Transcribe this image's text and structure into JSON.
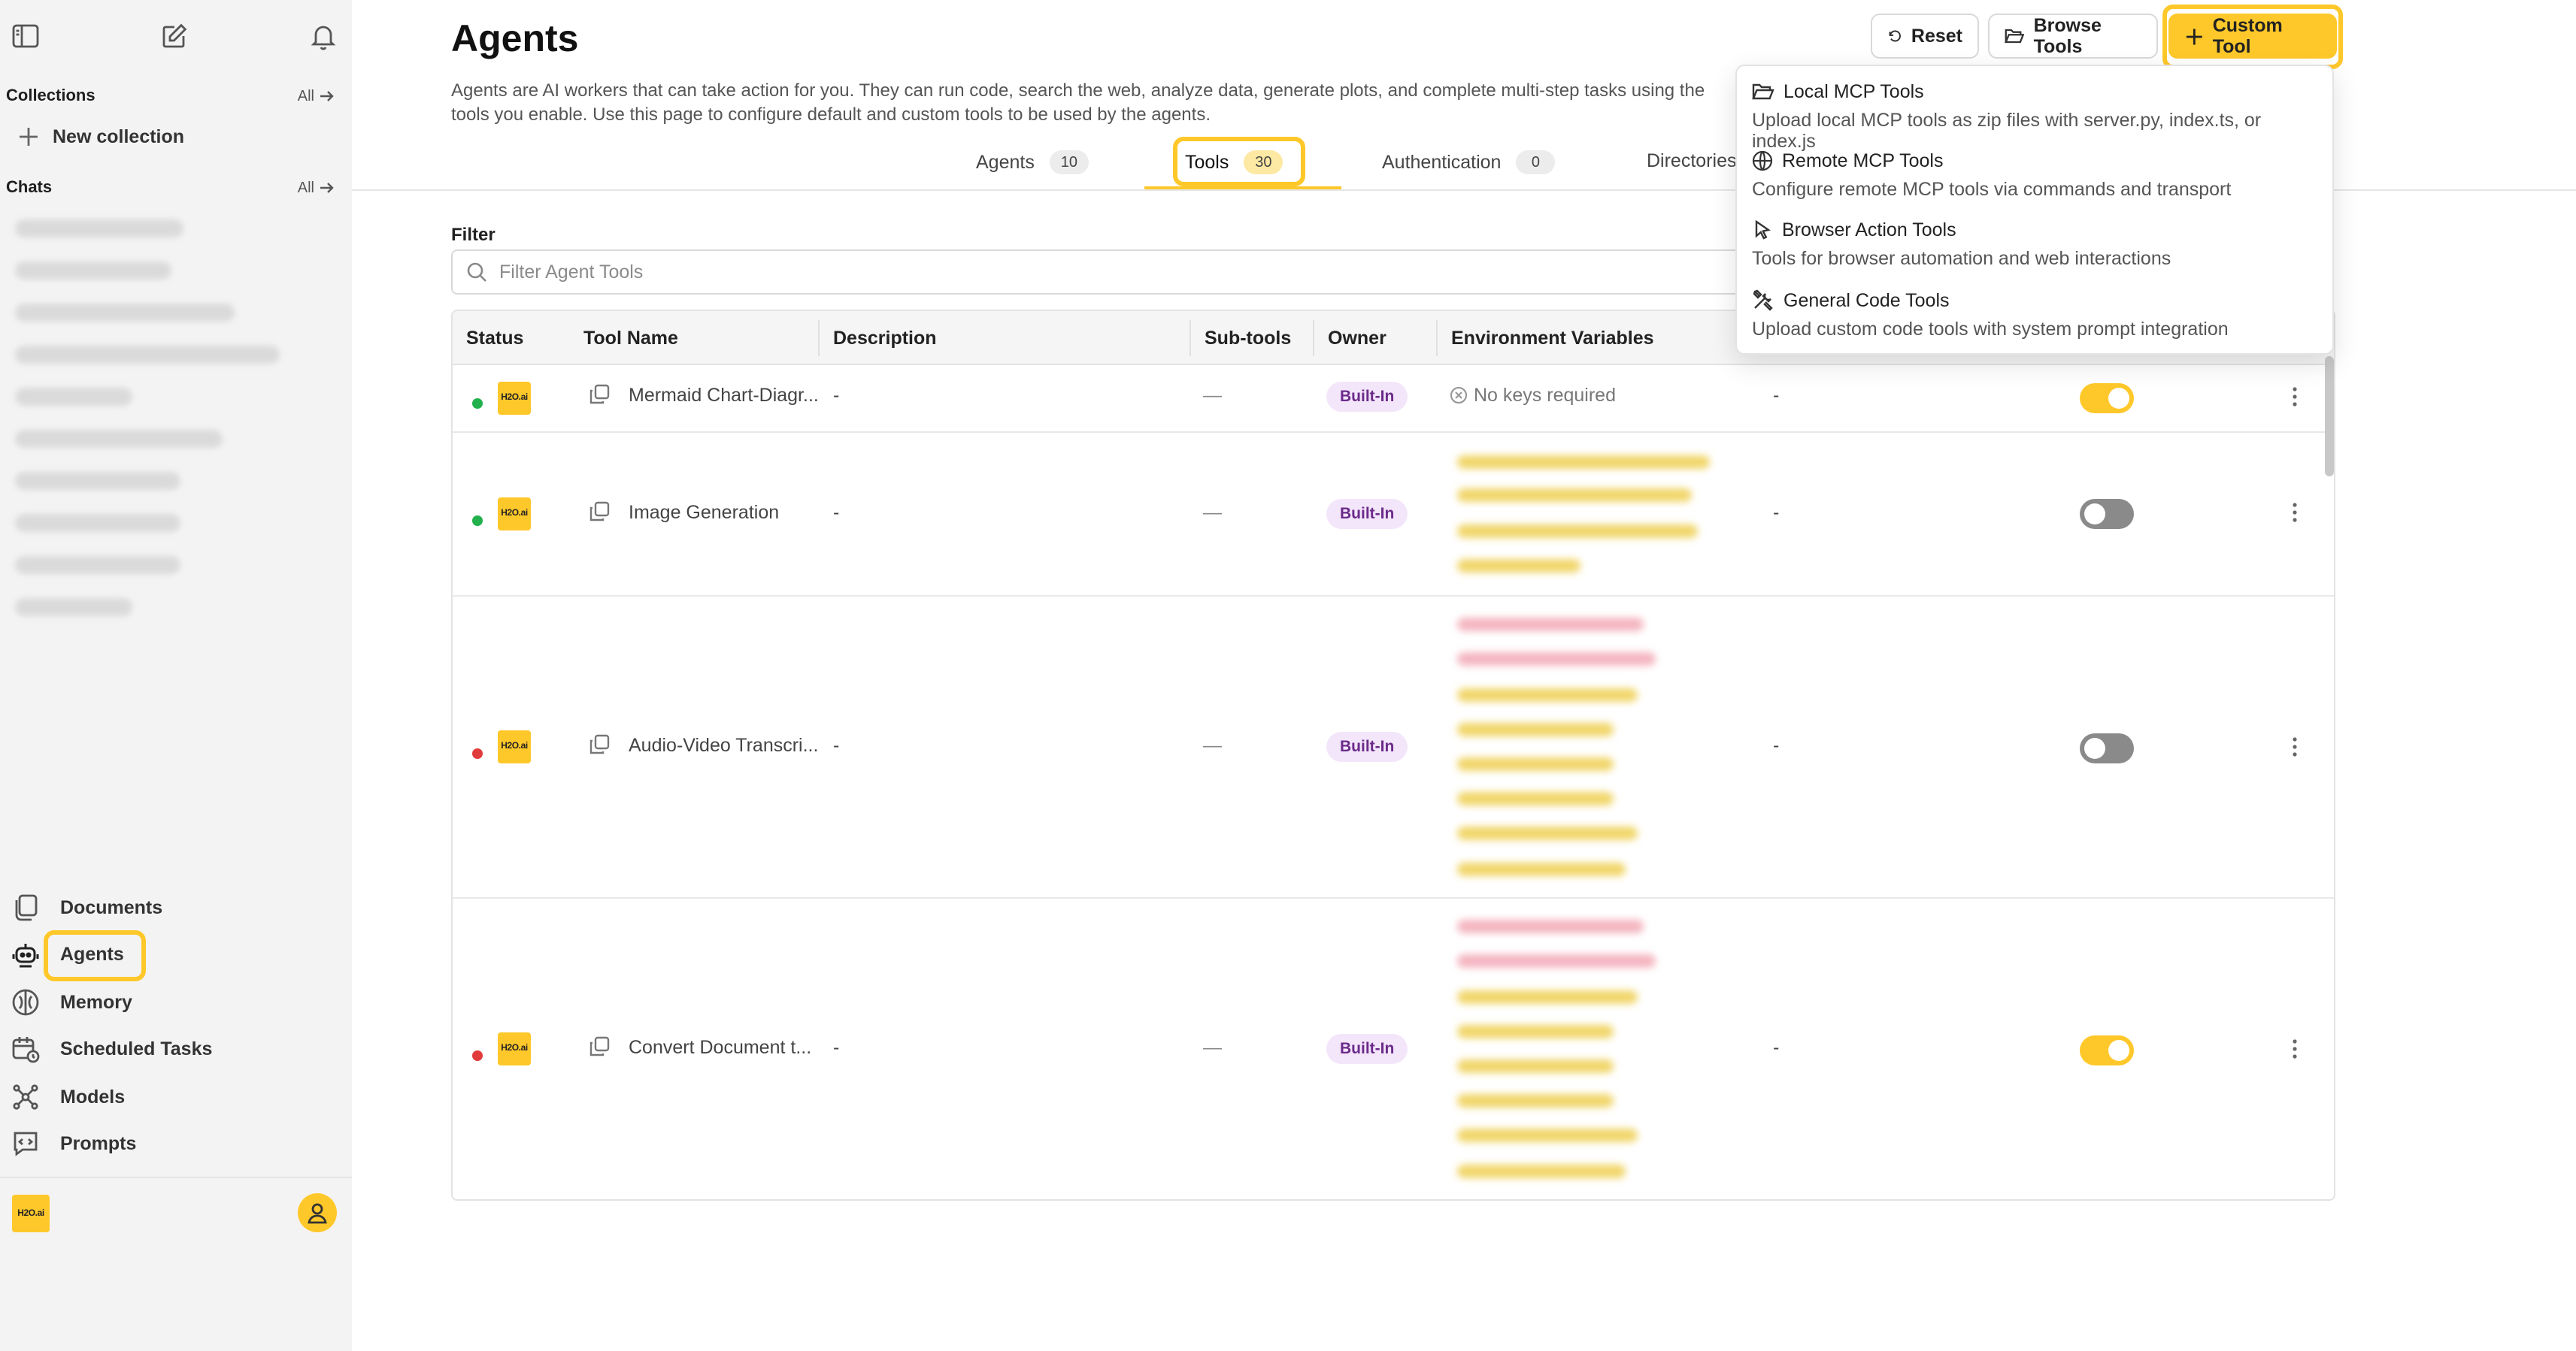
{
  "sidebar": {
    "collections_label": "Collections",
    "collections_all": "All",
    "new_collection": "New collection",
    "chats_label": "Chats",
    "chats_all": "All",
    "nav": [
      "Documents",
      "Agents",
      "Memory",
      "Scheduled Tasks",
      "Models",
      "Prompts"
    ],
    "logo_text": "H2O.ai"
  },
  "header": {
    "title": "Agents",
    "description": "Agents are AI workers that can take action for you. They can run code, search the web, analyze data, generate plots, and complete multi-step tasks using the tools you enable. Use this page to configure default and custom tools to be used by the agents.",
    "reset": "Reset",
    "browse_tools": "Browse Tools",
    "custom_tool": "Custom Tool"
  },
  "tabs": [
    {
      "label": "Agents",
      "count": "10"
    },
    {
      "label": "Tools",
      "count": "30"
    },
    {
      "label": "Authentication",
      "count": "0"
    },
    {
      "label": "Directories",
      "count": ""
    }
  ],
  "filter": {
    "label": "Filter",
    "placeholder": "Filter Agent Tools"
  },
  "table": {
    "columns": [
      "Status",
      "Tool Name",
      "Description",
      "Sub-tools",
      "Owner",
      "Environment Variables"
    ],
    "rows": [
      {
        "status_color": "#22b14c",
        "name": "Mermaid Chart-Diagr...",
        "description": "-",
        "subtools": "—",
        "owner": "Built-In",
        "env": "No keys required",
        "extra": "-",
        "enabled": true
      },
      {
        "status_color": "#22b14c",
        "name": "Image Generation",
        "description": "-",
        "subtools": "—",
        "owner": "Built-In",
        "env": "",
        "extra": "-",
        "enabled": false
      },
      {
        "status_color": "#e23b3b",
        "name": "Audio-Video Transcri...",
        "description": "-",
        "subtools": "—",
        "owner": "Built-In",
        "env": "",
        "extra": "-",
        "enabled": false
      },
      {
        "status_color": "#e23b3b",
        "name": "Convert Document t...",
        "description": "-",
        "subtools": "—",
        "owner": "Built-In",
        "env": "",
        "extra": "-",
        "enabled": true
      }
    ]
  },
  "dropdown": [
    {
      "icon": "folder-icon",
      "title": "Local MCP Tools",
      "subtitle": "Upload local MCP tools as zip files with server.py, index.ts, or index.js"
    },
    {
      "icon": "globe-icon",
      "title": "Remote MCP Tools",
      "subtitle": "Configure remote MCP tools via commands and transport"
    },
    {
      "icon": "cursor-icon",
      "title": "Browser Action Tools",
      "subtitle": "Tools for browser automation and web interactions"
    },
    {
      "icon": "tools-icon",
      "title": "General Code Tools",
      "subtitle": "Upload custom code tools with system prompt integration"
    }
  ],
  "colors": {
    "accent": "#ffc82a",
    "badge_bg": "#f3e6fb",
    "badge_text": "#6b2b8a"
  }
}
